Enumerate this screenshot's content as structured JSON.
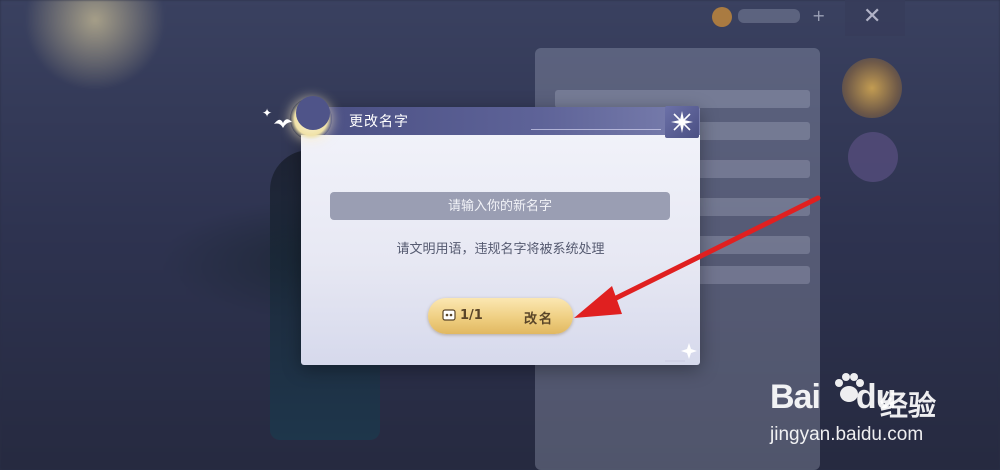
{
  "dialog": {
    "title": "更改名字",
    "input_placeholder": "请输入你的新名字",
    "hint": "请文明用语，违规名字将被系统处理",
    "rename_count": "1/1",
    "rename_label": "改名"
  },
  "watermark": {
    "brand_latin": "Bai",
    "brand_du": "du",
    "brand_cn": "经验",
    "url": "jingyan.baidu.com"
  },
  "annotation": {
    "arrow_color": "#e02020"
  },
  "colors": {
    "header": "#4a4f83",
    "button_gold": "#efcf82",
    "input_bg": "#9a9eb3"
  }
}
